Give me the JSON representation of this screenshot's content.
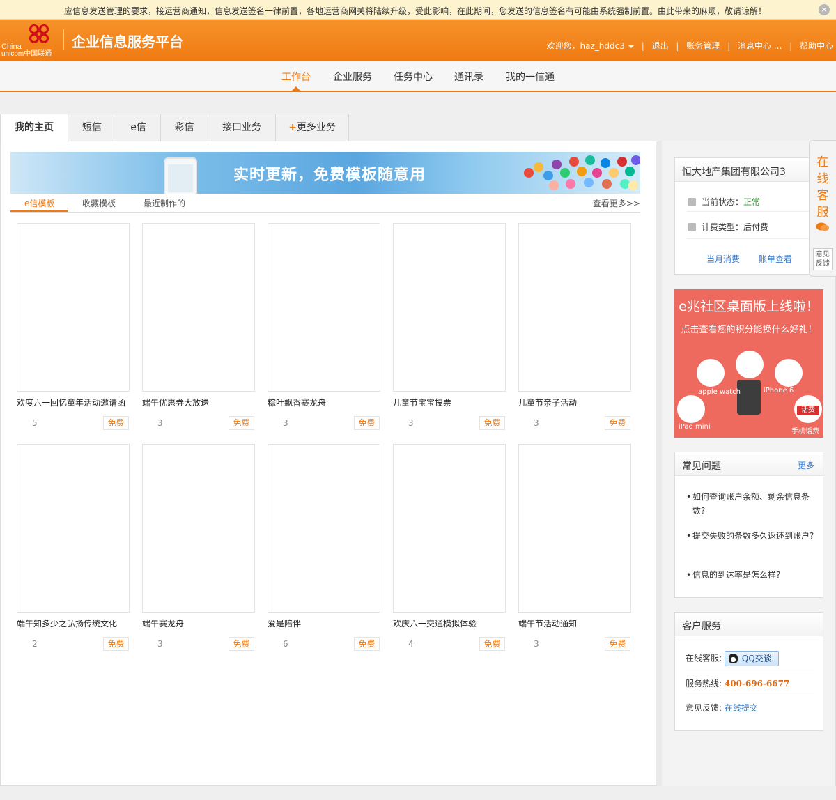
{
  "notice": {
    "text": "应信息发送管理的要求，接运营商通知，信息发送签名一律前置，各地运营商网关将陆续升级，受此影响，在此期间，您发送的信息签名有可能由系统强制前置。由此带来的麻烦，敬请谅解！",
    "close_icon": "×"
  },
  "header": {
    "logo_china": "China",
    "logo_unicom": "unicom中国联通",
    "app_title": "企业信息服务平台",
    "welcome": "欢迎您，haz_hddc3",
    "logout": "退出",
    "account_mgmt": "账务管理",
    "message_center": "消息中心 ...",
    "help_center": "帮助中心",
    "sep": "|"
  },
  "main_nav": [
    "工作台",
    "企业服务",
    "任务中心",
    "通讯录",
    "我的一信通"
  ],
  "sub_tabs": [
    "我的主页",
    "短信",
    "e信",
    "彩信",
    "接口业务",
    "更多业务"
  ],
  "sub_tab_more_prefix": "+",
  "banner": {
    "text": "实时更新，免费模板随意用"
  },
  "template_tabs": {
    "items": [
      "e信模板",
      "收藏模板",
      "最近制作的"
    ],
    "more": "查看更多>>"
  },
  "templates": [
    {
      "title": "欢度六一回忆童年活动邀请函",
      "count": "5",
      "badge": "免费"
    },
    {
      "title": "端午优惠券大放送",
      "count": "3",
      "badge": "免费"
    },
    {
      "title": "粽叶飘香赛龙舟",
      "count": "3",
      "badge": "免费"
    },
    {
      "title": "儿童节宝宝投票",
      "count": "3",
      "badge": "免费"
    },
    {
      "title": "儿童节亲子活动",
      "count": "3",
      "badge": "免费"
    },
    {
      "title": "端午知多少之弘扬传统文化",
      "count": "2",
      "badge": "免费"
    },
    {
      "title": "端午赛龙舟",
      "count": "3",
      "badge": "免费"
    },
    {
      "title": "爱是陪伴",
      "count": "6",
      "badge": "免费"
    },
    {
      "title": "欢庆六一交通模拟体验",
      "count": "4",
      "badge": "免费"
    },
    {
      "title": "端午节活动通知",
      "count": "3",
      "badge": "免费"
    }
  ],
  "account": {
    "company": "恒大地产集团有限公司3",
    "status_label": "当前状态：",
    "status_value": "正常",
    "billing_label": "计费类型：",
    "billing_value": "后付费",
    "monthly": "当月消费",
    "bill": "账单查看"
  },
  "promo": {
    "title": "e兆社区桌面版上线啦！",
    "subtitle": "点击查看您的积分能换什么好礼！",
    "labels": [
      "apple watch",
      "iPhone 6",
      "iPad mini",
      "手机话费"
    ],
    "phone_badge": "话费"
  },
  "faq": {
    "title": "常见问题",
    "more": "更多",
    "items": [
      "如何查询账户余额、剩余信息条数?",
      "提交失败的条数多久返还到账户?",
      "信息的到达率是怎么样?"
    ]
  },
  "service": {
    "title": "客户服务",
    "online_label": "在线客服:",
    "qq_button": "QQ交谈",
    "hotline_label": "服务热线:",
    "hotline_value": "400-696-6677",
    "feedback_label": "意见反馈:",
    "feedback_link": "在线提交"
  },
  "side_tab": {
    "chars": [
      "在",
      "线",
      "客",
      "服"
    ],
    "feedback": [
      "意见",
      "反馈"
    ]
  },
  "colors": {
    "accent": "#ef7a12",
    "link": "#3a7bc8",
    "status_ok": "#2c9a2c"
  }
}
